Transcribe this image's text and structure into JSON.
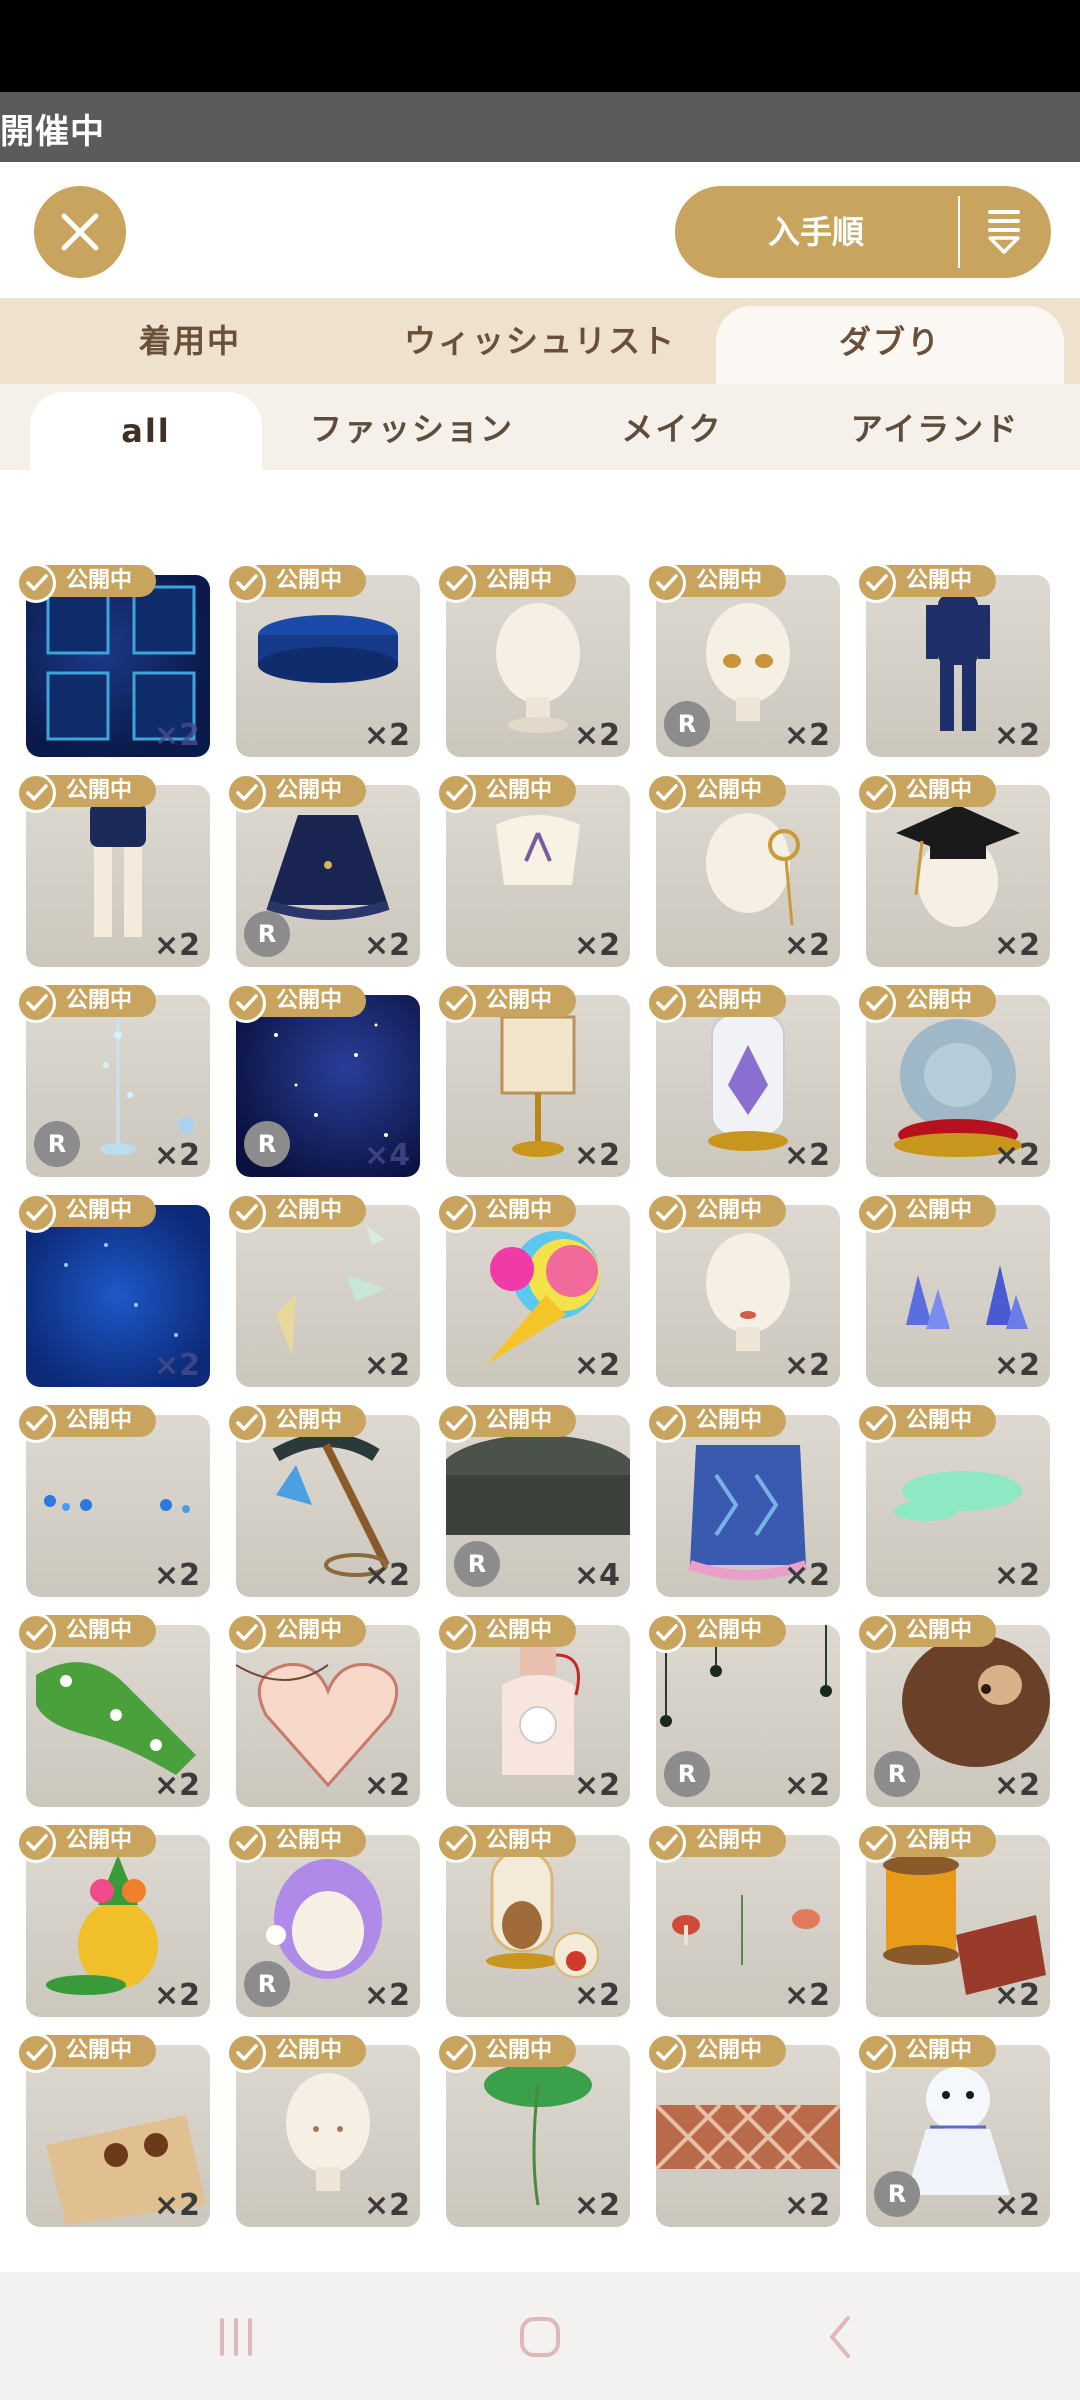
{
  "event_banner": {
    "text": "開催中"
  },
  "sort": {
    "label": "入手順",
    "icon": "sort-list-icon"
  },
  "close": {
    "icon": "close-icon"
  },
  "tabs": [
    {
      "label": "着用中",
      "active": false
    },
    {
      "label": "ウィッシュリスト",
      "active": false
    },
    {
      "label": "ダブり",
      "active": true
    }
  ],
  "subtabs": [
    {
      "label": "all",
      "active": true
    },
    {
      "label": "ファッション",
      "active": false
    },
    {
      "label": "メイク",
      "active": false
    },
    {
      "label": "アイランド",
      "active": false
    }
  ],
  "items": [
    {
      "badge": "公開中",
      "count": "×2",
      "rare": false,
      "art": "dark-cards"
    },
    {
      "badge": "公開中",
      "count": "×2",
      "rare": false,
      "art": "blue-base"
    },
    {
      "badge": "公開中",
      "count": "×2",
      "rare": false,
      "art": "head"
    },
    {
      "badge": "公開中",
      "count": "×2",
      "rare": true,
      "art": "head-eyes"
    },
    {
      "badge": "公開中",
      "count": "×2",
      "rare": false,
      "art": "pajamas"
    },
    {
      "badge": "公開中",
      "count": "×2",
      "rare": false,
      "art": "shorts"
    },
    {
      "badge": "公開中",
      "count": "×2",
      "rare": true,
      "art": "skirt"
    },
    {
      "badge": "公開中",
      "count": "×2",
      "rare": false,
      "art": "blouse"
    },
    {
      "badge": "公開中",
      "count": "×2",
      "rare": false,
      "art": "earring"
    },
    {
      "badge": "公開中",
      "count": "×2",
      "rare": false,
      "art": "grad-cap"
    },
    {
      "badge": "公開中",
      "count": "×2",
      "rare": true,
      "art": "fountain"
    },
    {
      "badge": "公開中",
      "count": "×4",
      "rare": true,
      "art": "starry"
    },
    {
      "badge": "公開中",
      "count": "×2",
      "rare": false,
      "art": "scroll"
    },
    {
      "badge": "公開中",
      "count": "×2",
      "rare": false,
      "art": "crystal-jar"
    },
    {
      "badge": "公開中",
      "count": "×2",
      "rare": false,
      "art": "shell"
    },
    {
      "badge": "公開中",
      "count": "×2",
      "rare": false,
      "art": "blue-floor"
    },
    {
      "badge": "公開中",
      "count": "×2",
      "rare": false,
      "art": "shards"
    },
    {
      "badge": "公開中",
      "count": "×2",
      "rare": false,
      "art": "rainbow-cone"
    },
    {
      "badge": "公開中",
      "count": "×2",
      "rare": false,
      "art": "head-lips"
    },
    {
      "badge": "公開中",
      "count": "×2",
      "rare": false,
      "art": "blue-crystals"
    },
    {
      "badge": "公開中",
      "count": "×2",
      "rare": false,
      "art": "blue-sparks"
    },
    {
      "badge": "公開中",
      "count": "×2",
      "rare": false,
      "art": "pickaxe"
    },
    {
      "badge": "公開中",
      "count": "×4",
      "rare": true,
      "art": "stone-pond"
    },
    {
      "badge": "公開中",
      "count": "×2",
      "rare": false,
      "art": "cape"
    },
    {
      "badge": "公開中",
      "count": "×2",
      "rare": false,
      "art": "green-puddle"
    },
    {
      "badge": "公開中",
      "count": "×2",
      "rare": false,
      "art": "clover"
    },
    {
      "badge": "公開中",
      "count": "×2",
      "rare": false,
      "art": "heart-sign"
    },
    {
      "badge": "公開中",
      "count": "×2",
      "rare": false,
      "art": "bottle"
    },
    {
      "badge": "公開中",
      "count": "×2",
      "rare": true,
      "art": "spiders"
    },
    {
      "badge": "公開中",
      "count": "×2",
      "rare": true,
      "art": "log"
    },
    {
      "badge": "公開中",
      "count": "×2",
      "rare": false,
      "art": "pineapple"
    },
    {
      "badge": "公開中",
      "count": "×2",
      "rare": true,
      "art": "purple-hair"
    },
    {
      "badge": "公開中",
      "count": "×2",
      "rare": false,
      "art": "terrarium"
    },
    {
      "badge": "公開中",
      "count": "×2",
      "rare": false,
      "art": "mushrooms"
    },
    {
      "badge": "公開中",
      "count": "×2",
      "rare": false,
      "art": "thread"
    },
    {
      "badge": "公開中",
      "count": "×2",
      "rare": false,
      "art": "map"
    },
    {
      "badge": "公開中",
      "count": "×2",
      "rare": false,
      "art": "head-plain"
    },
    {
      "badge": "公開中",
      "count": "×2",
      "rare": false,
      "art": "leaf"
    },
    {
      "badge": "公開中",
      "count": "×2",
      "rare": false,
      "art": "lattice"
    },
    {
      "badge": "公開中",
      "count": "×2",
      "rare": true,
      "art": "teru-bozu"
    }
  ],
  "nav": {
    "recent": "recent-apps-icon",
    "home": "home-icon",
    "back": "back-icon"
  },
  "colors": {
    "accent": "#c9a45f",
    "tab_bg": "#eee2cf",
    "subtab_bg": "#f5f1ea"
  }
}
